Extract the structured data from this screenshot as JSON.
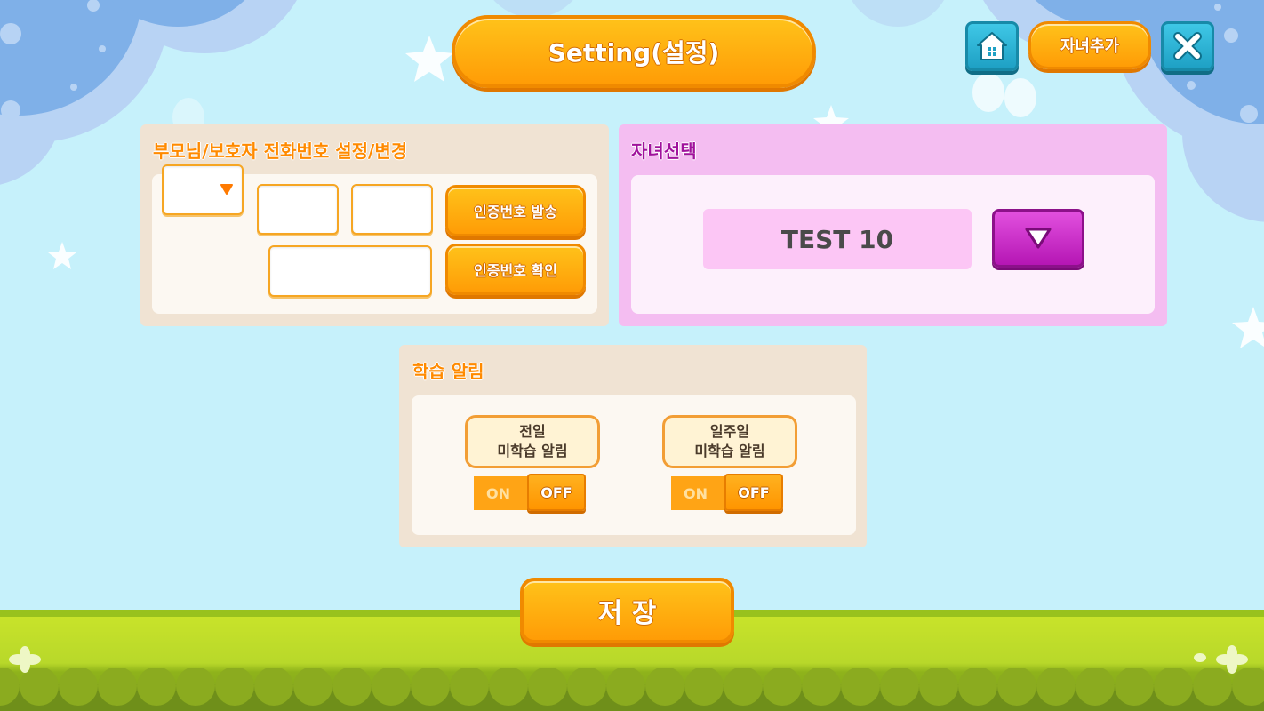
{
  "header": {
    "title": "Setting(설정)",
    "home_icon": "home-icon",
    "add_child_label": "자녀추가",
    "close_icon": "close-icon"
  },
  "phone_panel": {
    "title": "부모님/보호자 전화번호 설정/변경",
    "prefix_select_value": "",
    "phone_mid_value": "",
    "phone_last_value": "",
    "verification_code_value": "",
    "send_code_label": "인증번호 발송",
    "confirm_code_label": "인증번호 확인"
  },
  "child_panel": {
    "title": "자녀선택",
    "selected_child": "TEST 10"
  },
  "notify_panel": {
    "title": "학습 알림",
    "items": [
      {
        "line1": "전일",
        "line2": "미학습 알림",
        "on_label": "ON",
        "off_label": "OFF",
        "state": "OFF"
      },
      {
        "line1": "일주일",
        "line2": "미학습 알림",
        "on_label": "ON",
        "off_label": "OFF",
        "state": "OFF"
      }
    ]
  },
  "save_label": "저 장",
  "colors": {
    "sky": "#c6f1fb",
    "orange": "#ff9c06",
    "panel_beige": "#f0e3d3",
    "panel_pink": "#f4bdf1",
    "child_value_bg": "#fcc6f5",
    "purple_button": "#c726c6",
    "grass": "#b8d82a"
  }
}
